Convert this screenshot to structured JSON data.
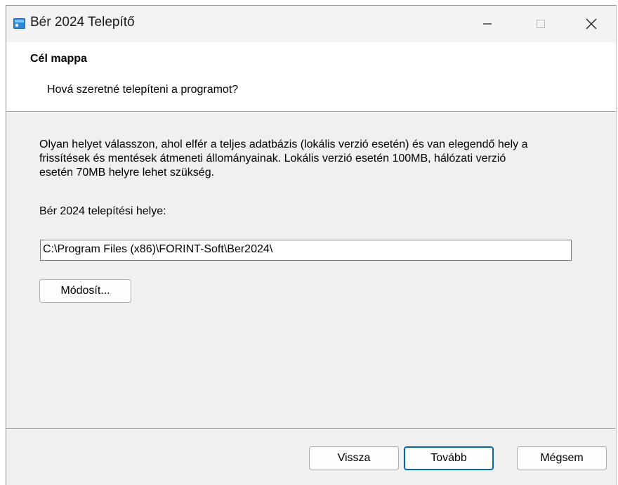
{
  "window": {
    "title": "Bér 2024 Telepítő",
    "icon": "installer-icon",
    "controls": {
      "minimize": "minimize-icon",
      "maximize": "maximize-icon",
      "close": "close-icon"
    }
  },
  "header": {
    "title": "Cél mappa",
    "subtitle": "Hová szeretné telepíteni a programot?"
  },
  "body": {
    "description": "Olyan helyet válasszon, ahol elfér a teljes adatbázis (lokális verzió esetén) és van elegendő hely a frissítések és mentések átmeneti állományainak. Lokális verzió esetén 100MB, hálózati verzió esetén 70MB helyre lehet szükség.",
    "location_label": "Bér 2024 telepítési helye:",
    "install_path": "C:\\Program Files (x86)\\FORINT-Soft\\Ber2024\\",
    "browse_label": "Módosít..."
  },
  "footer": {
    "back_label": "Vissza",
    "next_label": "Tovább",
    "cancel_label": "Mégsem"
  },
  "colors": {
    "accent": "#0067c0",
    "dialog_bg": "#f0f0f0",
    "header_bg": "#ffffff"
  }
}
